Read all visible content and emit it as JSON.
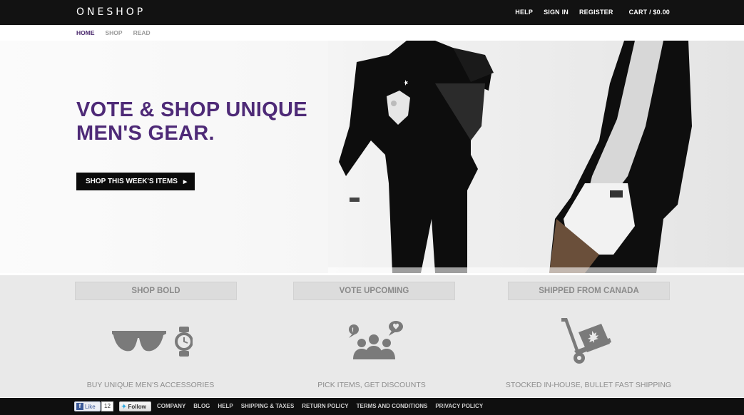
{
  "header": {
    "logo": "ONESHOP",
    "nav": {
      "help": "HELP",
      "signin": "SIGN IN",
      "register": "REGISTER",
      "cart": "CART / $0.00"
    }
  },
  "subnav": {
    "home": "HOME",
    "shop": "SHOP",
    "read": "READ"
  },
  "hero": {
    "headline": "VOTE & SHOP UNIQUE MEN'S GEAR.",
    "button_label": "SHOP THIS WEEK'S ITEMS",
    "button_arrow": "▶"
  },
  "features": [
    {
      "title": "SHOP BOLD",
      "text": "BUY UNIQUE MEN'S ACCESSORIES",
      "icon": "sunglasses-watch-icon"
    },
    {
      "title": "VOTE UPCOMING",
      "text": "PICK ITEMS, GET DISCOUNTS",
      "icon": "people-vote-icon"
    },
    {
      "title": "SHIPPED FROM CANADA",
      "text": "STOCKED IN-HOUSE, BULLET FAST SHIPPING",
      "icon": "hand-truck-maple-icon"
    }
  ],
  "footer": {
    "fb_like": "Like",
    "fb_count": "12",
    "tw_follow": "Follow",
    "links": [
      "COMPANY",
      "BLOG",
      "HELP",
      "SHIPPING & TAXES",
      "RETURN POLICY",
      "TERMS AND CONDITIONS",
      "PRIVACY POLICY"
    ]
  },
  "colors": {
    "accent": "#4e2a77",
    "topbar": "#121212",
    "feature_bg": "#e9e9e9"
  }
}
